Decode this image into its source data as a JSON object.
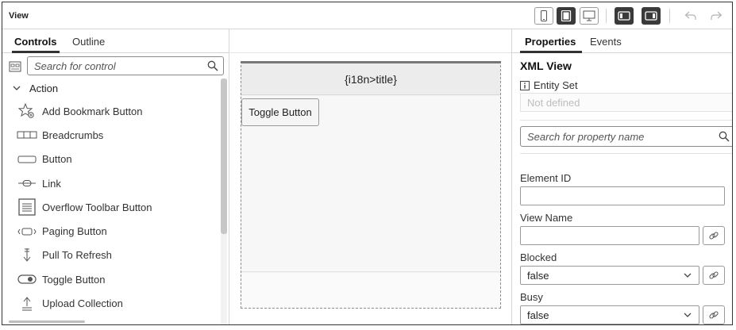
{
  "topbar": {
    "title": "View",
    "device_buttons": [
      {
        "icon": "phone-icon",
        "active": false
      },
      {
        "icon": "tablet-icon",
        "active": true
      },
      {
        "icon": "desktop-icon",
        "active": false
      }
    ],
    "panel_buttons": [
      {
        "icon": "left-panel-icon",
        "active": true
      },
      {
        "icon": "right-panel-icon",
        "active": true
      }
    ],
    "history_buttons": [
      {
        "icon": "undo-icon"
      },
      {
        "icon": "redo-icon"
      }
    ]
  },
  "left_panel": {
    "tabs": [
      "Controls",
      "Outline"
    ],
    "selected_tab": "Controls",
    "search": {
      "placeholder": "Search for control",
      "value": ""
    },
    "group": {
      "label": "Action",
      "expanded": true
    },
    "controls": [
      {
        "label": "Add Bookmark Button",
        "icon": "bookmark-star-icon"
      },
      {
        "label": "Breadcrumbs",
        "icon": "breadcrumbs-icon"
      },
      {
        "label": "Button",
        "icon": "button-icon"
      },
      {
        "label": "Link",
        "icon": "link-icon"
      },
      {
        "label": "Overflow Toolbar Button",
        "icon": "overflow-toolbar-icon"
      },
      {
        "label": "Paging Button",
        "icon": "paging-button-icon"
      },
      {
        "label": "Pull To Refresh",
        "icon": "pull-to-refresh-icon"
      },
      {
        "label": "Toggle Button",
        "icon": "toggle-icon"
      },
      {
        "label": "Upload Collection",
        "icon": "upload-icon"
      }
    ]
  },
  "canvas": {
    "page_title": "{i18n>title}",
    "button_label": "Toggle Button"
  },
  "right_panel": {
    "tabs": [
      "Properties",
      "Events"
    ],
    "selected_tab": "Properties",
    "heading": "XML View",
    "entity_set": {
      "label": "Entity Set",
      "placeholder": "Not defined"
    },
    "search": {
      "placeholder": "Search for property name",
      "value": ""
    },
    "element_id": {
      "label": "Element ID",
      "value": ""
    },
    "view_name": {
      "label": "View Name",
      "value": ""
    },
    "blocked": {
      "label": "Blocked",
      "value": "false"
    },
    "busy": {
      "label": "Busy",
      "value": "false"
    }
  },
  "colors": {
    "active_toggle": "#3a3a3a",
    "border": "#9a9a9a",
    "canvas_bg": "#f4f4f4"
  }
}
